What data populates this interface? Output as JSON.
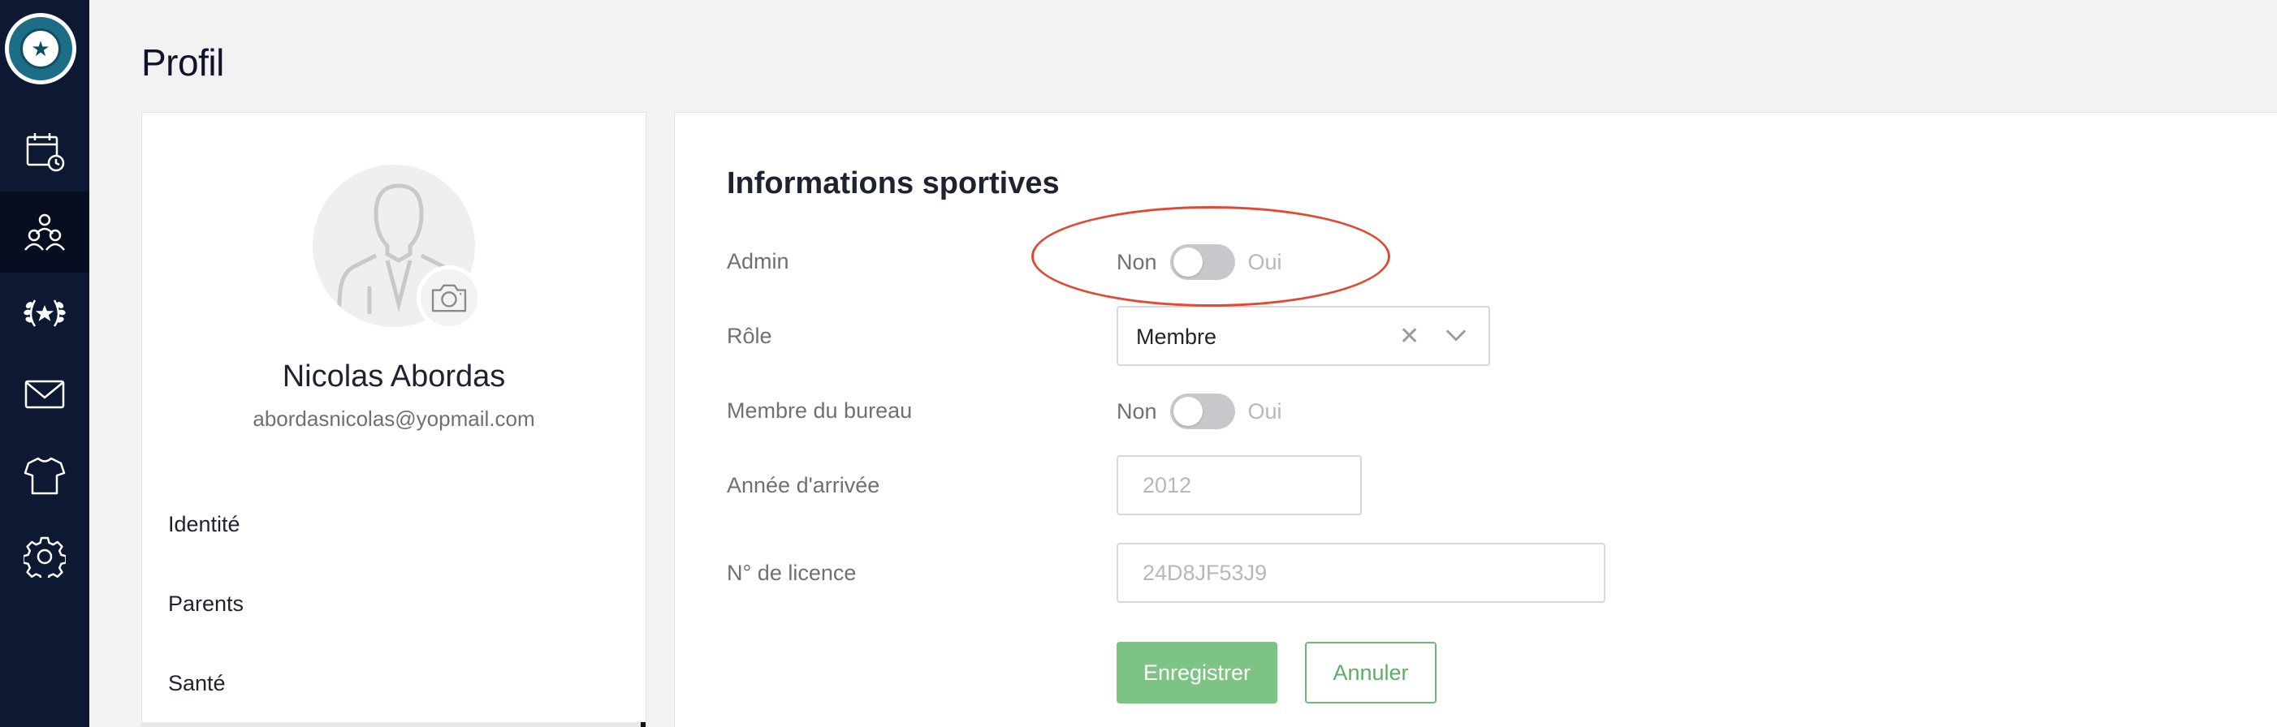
{
  "app": {
    "logo_name": "club-logo",
    "logo_icon": "star"
  },
  "sidebar": {
    "items": [
      {
        "name": "calendar-icon",
        "active": false
      },
      {
        "name": "members-icon",
        "active": true
      },
      {
        "name": "laurel-icon",
        "active": false
      },
      {
        "name": "mail-icon",
        "active": false
      },
      {
        "name": "jersey-icon",
        "active": false
      },
      {
        "name": "gear-icon",
        "active": false
      }
    ]
  },
  "page": {
    "title": "Profil"
  },
  "profile": {
    "name": "Nicolas Abordas",
    "email": "abordasnicolas@yopmail.com",
    "menu": [
      "Identité",
      "Parents",
      "Santé"
    ]
  },
  "sports_info": {
    "title": "Informations sportives",
    "admin": {
      "label": "Admin",
      "off_label": "Non",
      "on_label": "Oui",
      "value": false
    },
    "role": {
      "label": "Rôle",
      "value": "Membre",
      "clear_symbol": "✕"
    },
    "board_member": {
      "label": "Membre du bureau",
      "off_label": "Non",
      "on_label": "Oui",
      "value": false
    },
    "arrival_year": {
      "label": "Année d'arrivée",
      "placeholder": "2012"
    },
    "license": {
      "label": "N° de licence",
      "placeholder": "24D8JF53J9"
    },
    "save_label": "Enregistrer",
    "cancel_label": "Annuler"
  },
  "colors": {
    "sidebar_bg": "#0d1832",
    "primary_green": "#7dc384",
    "annotation_red": "#e04a33"
  }
}
